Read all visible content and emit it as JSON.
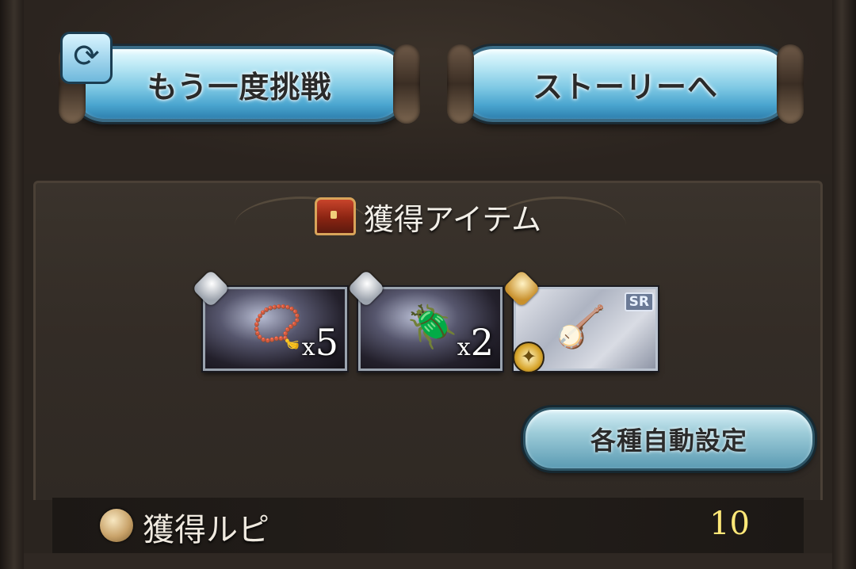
{
  "buttons": {
    "retry_label": "もう一度挑戦",
    "retry_icon": "refresh-icon",
    "story_label": "ストーリーへ",
    "auto_settings_label": "各種自動設定"
  },
  "items_section": {
    "title": "獲得アイテム",
    "icon": "treasure-chest-icon",
    "items": [
      {
        "name": "rosary",
        "rarity": "silver",
        "quantity_prefix": "x",
        "quantity": "5"
      },
      {
        "name": "figurine",
        "rarity": "silver",
        "quantity_prefix": "x",
        "quantity": "2"
      },
      {
        "name": "harp-weapon",
        "rarity": "gold",
        "badge": "SR",
        "element": "light"
      }
    ]
  },
  "rupie": {
    "label": "獲得ルピ",
    "value": "10",
    "icon": "rupie-coin-icon"
  },
  "colors": {
    "button_blue": "#7fc9e4",
    "rupie_value": "#ffe878",
    "background": "#2a241f"
  }
}
